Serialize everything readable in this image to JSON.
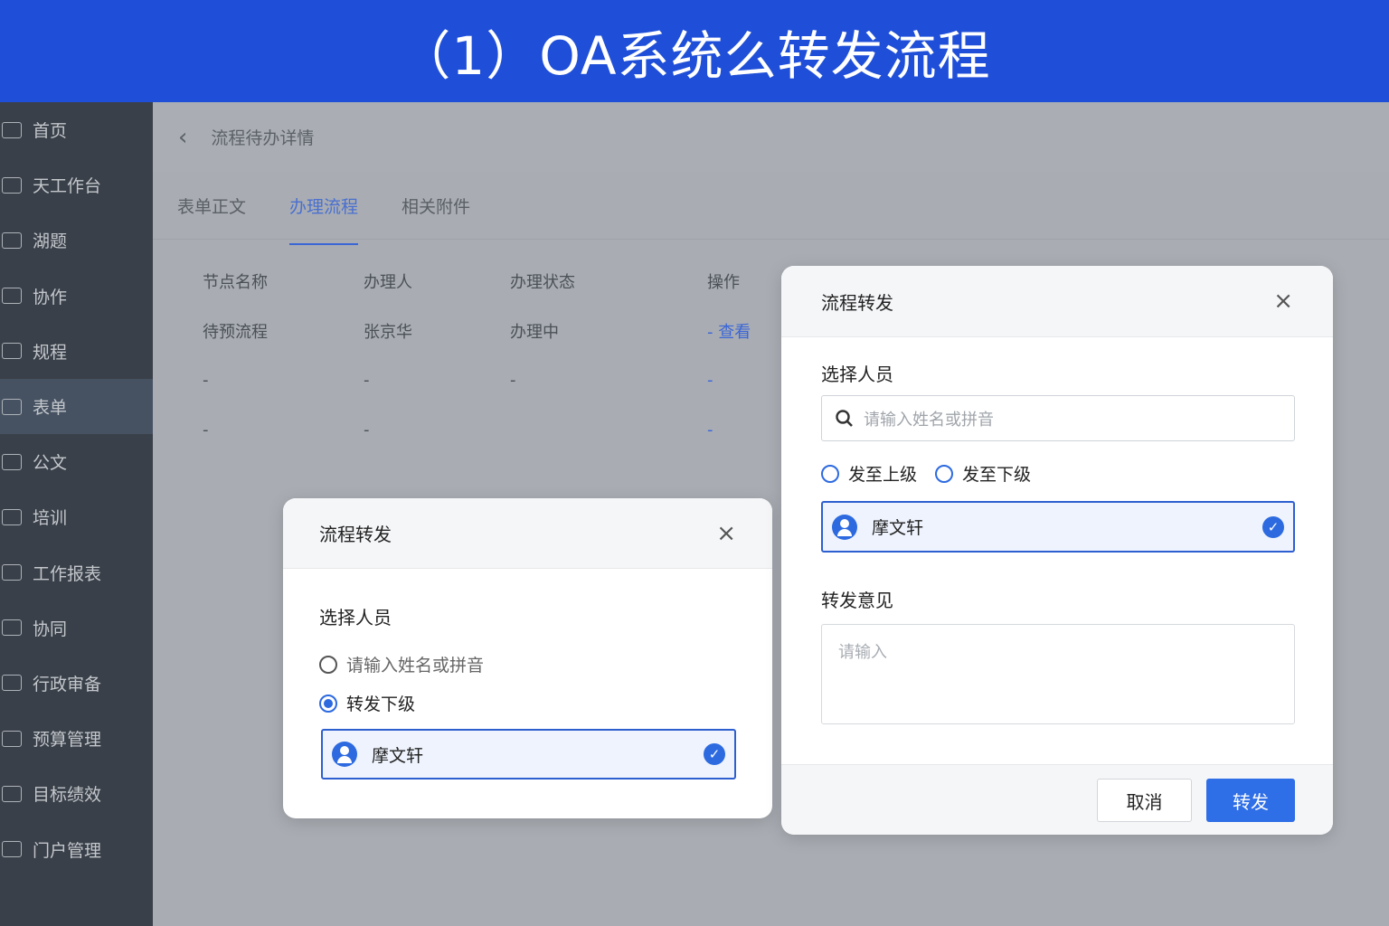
{
  "banner": {
    "title": "（1）OA系统么转发流程"
  },
  "sidebar": {
    "items": [
      {
        "label": "首页"
      },
      {
        "label": "天工作台"
      },
      {
        "label": "湖题"
      },
      {
        "label": "协作"
      },
      {
        "label": "规程"
      },
      {
        "label": "表单"
      },
      {
        "label": "公文"
      },
      {
        "label": "培训"
      },
      {
        "label": "工作报表"
      },
      {
        "label": "协同"
      },
      {
        "label": "行政审备"
      },
      {
        "label": "预算管理"
      },
      {
        "label": "目标绩效"
      },
      {
        "label": "门户管理"
      }
    ]
  },
  "main": {
    "breadcrumb": "流程待办详情",
    "tabs": [
      {
        "label": "表单正文"
      },
      {
        "label": "办理流程"
      },
      {
        "label": "相关附件"
      }
    ],
    "table": {
      "headers": [
        "节点名称",
        "办理人",
        "办理状态",
        "操作"
      ],
      "rows": [
        [
          "待预流程",
          "张京华",
          "办理中",
          "- 查看"
        ],
        [
          "-",
          "-",
          "-",
          "-"
        ],
        [
          "-",
          "-",
          "",
          "-"
        ]
      ]
    }
  },
  "dialog_small": {
    "title": "流程转发",
    "section": "选择人员",
    "options": [
      "请输入姓名或拼音",
      "转发下级"
    ],
    "person": "摩文轩"
  },
  "dialog_large": {
    "title": "流程转发",
    "section": "选择人员",
    "search_placeholder": "请输入姓名或拼音",
    "options": [
      "发至上级",
      "发至下级"
    ],
    "person": "摩文轩",
    "opinion_label": "转发意见",
    "opinion_placeholder": "请输入",
    "cancel": "取消",
    "confirm": "转发"
  }
}
